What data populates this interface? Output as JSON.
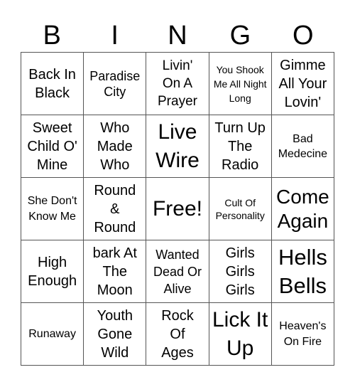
{
  "header": {
    "letters": [
      "B",
      "I",
      "N",
      "G",
      "O"
    ]
  },
  "cells": [
    [
      "Back In Black",
      "Paradise City",
      "Livin' On A Prayer",
      "You Shook Me All Night Long",
      "Gimme All Your Lovin'"
    ],
    [
      "Sweet Child O' Mine",
      "Who Made Who",
      "Live Wire",
      "Turn Up The Radio",
      "Bad Medecine"
    ],
    [
      "She Don't Know Me",
      "Round & Round",
      "Free!",
      "Cult Of Personality",
      "Come Again"
    ],
    [
      "High Enough",
      "bark At The Moon",
      "Wanted Dead Or Alive",
      "Girls Girls Girls",
      "Hells Bells"
    ],
    [
      "Runaway",
      "Youth Gone Wild",
      "Rock Of Ages",
      "Lick It Up",
      "Heaven's On Fire"
    ]
  ]
}
